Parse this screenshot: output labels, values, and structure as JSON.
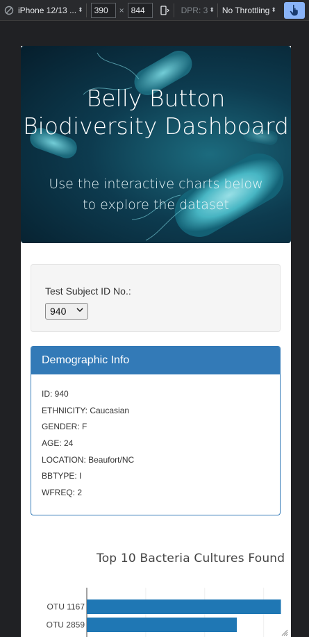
{
  "devtools": {
    "device": "iPhone 12/13 ...",
    "width": "390",
    "times": "×",
    "height": "844",
    "dpr": "DPR: 3",
    "throttling": "No Throttling"
  },
  "hero": {
    "title": "Belly Button Biodiversity Dashboard",
    "subtitle": "Use the interactive charts below to explore the dataset"
  },
  "selector": {
    "label": "Test Subject ID No.:",
    "value": "940"
  },
  "demographic": {
    "heading": "Demographic Info",
    "rows": [
      "ID: 940",
      "ETHNICITY: Caucasian",
      "GENDER: F",
      "AGE: 24",
      "LOCATION: Beaufort/NC",
      "BBTYPE: I",
      "WFREQ: 2"
    ]
  },
  "colors": {
    "accent": "#337ab7",
    "bar": "#1f77b4"
  },
  "chart_data": {
    "type": "bar",
    "orientation": "horizontal",
    "title": "Top 10 Bacteria Cultures Found",
    "categories": [
      "OTU 1167",
      "OTU 2859"
    ],
    "values": [
      163,
      126
    ],
    "xlim": [
      0,
      165
    ],
    "grid": true
  }
}
